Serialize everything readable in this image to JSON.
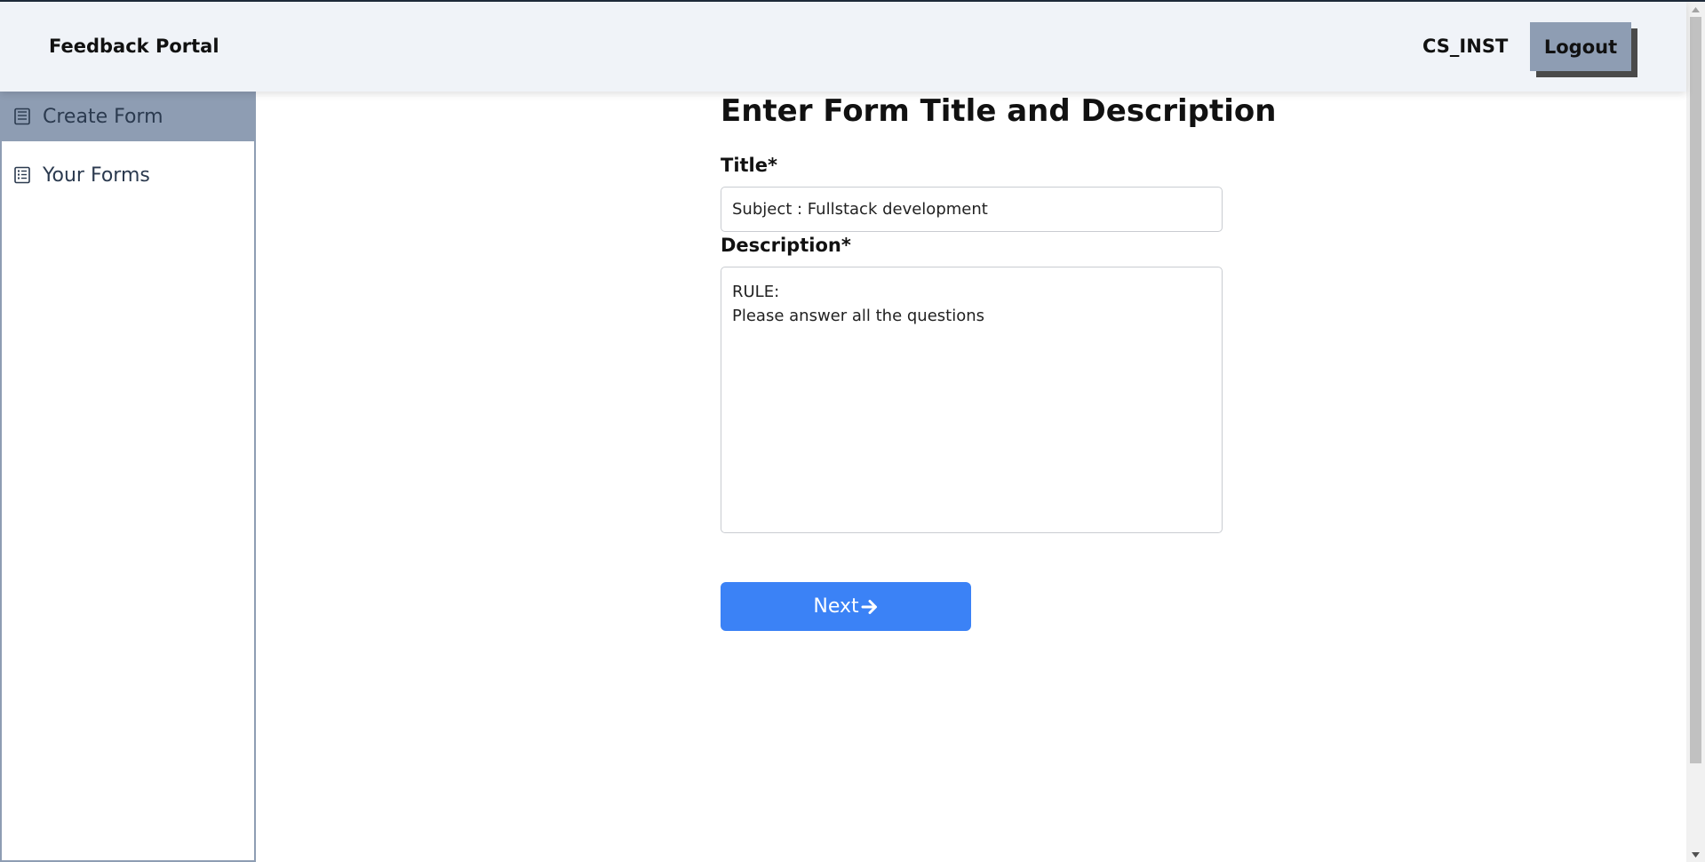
{
  "header": {
    "brand": "Feedback Portal",
    "username": "CS_INST",
    "logout_label": "Logout"
  },
  "sidebar": {
    "items": [
      {
        "label": "Create Form",
        "icon": "form-icon",
        "active": true
      },
      {
        "label": "Your Forms",
        "icon": "form-list-icon",
        "active": false
      }
    ]
  },
  "form": {
    "heading": "Enter Form Title and Description",
    "title_label": "Title*",
    "title_value": "Subject : Fullstack development",
    "description_label": "Description*",
    "description_value": "RULE:\nPlease answer all the questions",
    "next_label": "Next",
    "next_icon": "arrow-right-icon"
  },
  "colors": {
    "header_bg": "#f0f3f8",
    "accent_slate": "#8e9db3",
    "primary_button": "#3b82f6"
  }
}
